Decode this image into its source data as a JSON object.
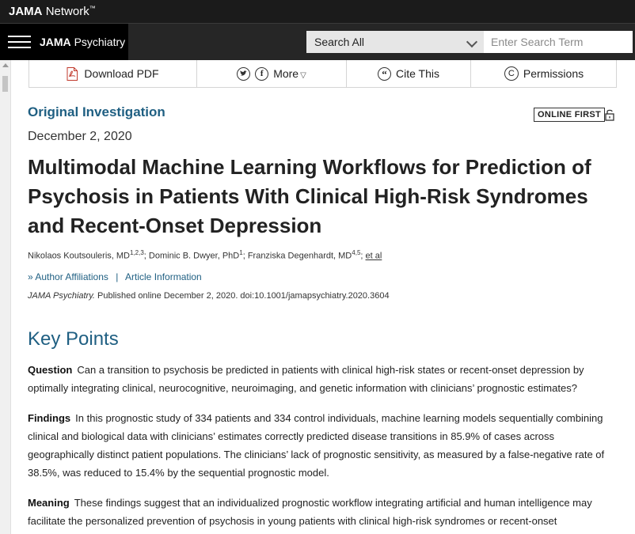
{
  "header": {
    "network_brand": "JAMA",
    "network_word": "Network",
    "journal_brand": "JAMA",
    "journal_word": "Psychiatry",
    "search_scope": "Search All",
    "search_placeholder": "Enter Search Term"
  },
  "toolbar": {
    "download_pdf": "Download PDF",
    "more": "More",
    "cite_this": "Cite This",
    "permissions": "Permissions"
  },
  "article": {
    "type": "Original Investigation",
    "badge": "ONLINE FIRST",
    "date": "December 2, 2020",
    "title": "Multimodal Machine Learning Workflows for Prediction of Psychosis in Patients With Clinical High-Risk Syndromes and Recent-Onset Depression",
    "authors": [
      {
        "name": "Nikolaos Koutsouleris, MD",
        "sup": "1,2,3"
      },
      {
        "name": "Dominic B. Dwyer, PhD",
        "sup": "1"
      },
      {
        "name": "Franziska Degenhardt, MD",
        "sup": "4,5"
      }
    ],
    "et_al": "et al",
    "author_affiliations": "Author Affiliations",
    "article_information": "Article Information",
    "journal_italic": "JAMA Psychiatry.",
    "citation_rest": "Published online December 2, 2020. doi:10.1001/jamapsychiatry.2020.3604"
  },
  "key_points": {
    "heading": "Key Points",
    "question_label": "Question",
    "question_text": "Can a transition to psychosis be predicted in patients with clinical high-risk states or recent-onset depression by optimally integrating clinical, neurocognitive, neuroimaging, and genetic information with clinicians’ prognostic estimates?",
    "findings_label": "Findings",
    "findings_text": "In this prognostic study of 334 patients and 334 control individuals, machine learning models sequentially combining clinical and biological data with clinicians’ estimates correctly predicted disease transitions in 85.9% of cases across geographically distinct patient populations. The clinicians’ lack of prognostic sensitivity, as measured by a false-negative rate of 38.5%, was reduced to 15.4% by the sequential prognostic model.",
    "meaning_label": "Meaning",
    "meaning_text": "These findings suggest that an individualized prognostic workflow integrating artificial and human intelligence may facilitate the personalized prevention of psychosis in young patients with clinical high-risk syndromes or recent-onset"
  },
  "colors": {
    "accent_blue": "#1f5f82",
    "topbar": "#1b1b1b",
    "navbar": "#262626"
  },
  "icons": {
    "menu": "hamburger-icon",
    "pdf": "pdf-icon",
    "twitter": "twitter-icon",
    "facebook": "facebook-icon",
    "cite": "quote-icon",
    "permissions": "copyright-icon",
    "lock": "unlock-icon"
  }
}
